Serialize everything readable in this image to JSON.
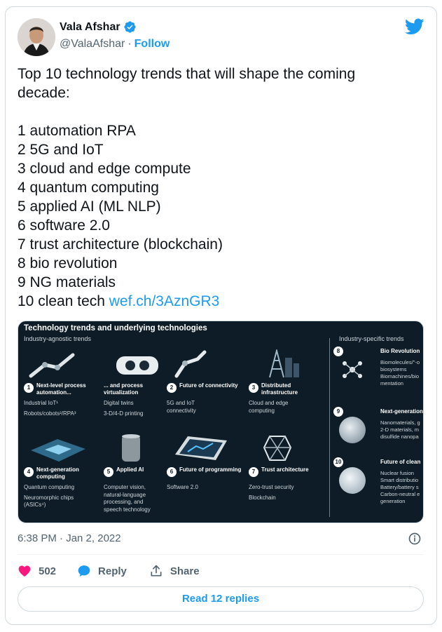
{
  "tweet": {
    "author_name": "Vala Afshar",
    "handle": "@ValaAfshar",
    "separator": "·",
    "follow_label": "Follow",
    "text_lines": [
      "Top 10 technology trends that will shape the coming",
      "decade:",
      "",
      "1 automation RPA",
      "2 5G and IoT",
      "3 cloud and edge compute",
      "4 quantum computing",
      "5 applied AI (ML NLP)",
      "6 software 2.0",
      "7 trust architecture (blockchain)",
      "8 bio revolution",
      "9 NG materials"
    ],
    "last_line_prefix": "10 clean tech ",
    "link_text": "wef.ch/3AznGR3",
    "timestamp": "6:38 PM · Jan 2, 2022",
    "likes_count": "502",
    "reply_label": "Reply",
    "share_label": "Share",
    "read_replies_label": "Read 12 replies"
  },
  "infographic": {
    "title": "Technology trends and underlying technologies",
    "left_section_label": "Industry-agnostic trends",
    "right_section_label": "Industry-specific trends",
    "tiles": [
      {
        "num": "1",
        "head": "Next-level process automation...",
        "body": "Industrial IoT¹\nRobots/cobots²/RPA³"
      },
      {
        "num": "",
        "head": "... and process virtualization",
        "body": "Digital twins\n3-D/4-D printing"
      },
      {
        "num": "2",
        "head": "Future of connectivity",
        "body": "5G and IoT\nconnectivity"
      },
      {
        "num": "3",
        "head": "Distributed infrastructure",
        "body": "Cloud and edge\ncomputing"
      },
      {
        "num": "4",
        "head": "Next-generation computing",
        "body": "Quantum computing\nNeuromorphic chips\n(ASICs⁴)"
      },
      {
        "num": "5",
        "head": "Applied AI",
        "body": "Computer vision,\nnatural-language\nprocessing, and\nspeech technology"
      },
      {
        "num": "6",
        "head": "Future of programming",
        "body": "Software 2.0"
      },
      {
        "num": "7",
        "head": "Trust architecture",
        "body": "Zero-trust security\nBlockchain"
      }
    ],
    "right_tiles": [
      {
        "num": "8",
        "head": "Bio Revolution",
        "body": "Biomolecules/\"-o\nbiosystems\nBiomachines/bio\nmentation"
      },
      {
        "num": "9",
        "head": "Next-generation",
        "body": "Nanomaterials, g\n2-D materials, m\ndisulfide nanopa"
      },
      {
        "num": "10",
        "head": "Future of clean",
        "body": "Nuclear fusion\nSmart distributio\nBattery/battery s\nCarbon-neutral e\ngeneration"
      }
    ]
  },
  "colors": {
    "accent": "#1d9bf0",
    "like": "#f91880",
    "muted": "#536471",
    "media_bg": "#0d1c26"
  },
  "icons": {
    "verified": "verified-badge-icon",
    "brand": "twitter-bird-icon",
    "info": "info-icon",
    "like": "heart-icon",
    "reply": "speech-bubble-icon",
    "share": "share-upload-icon"
  }
}
